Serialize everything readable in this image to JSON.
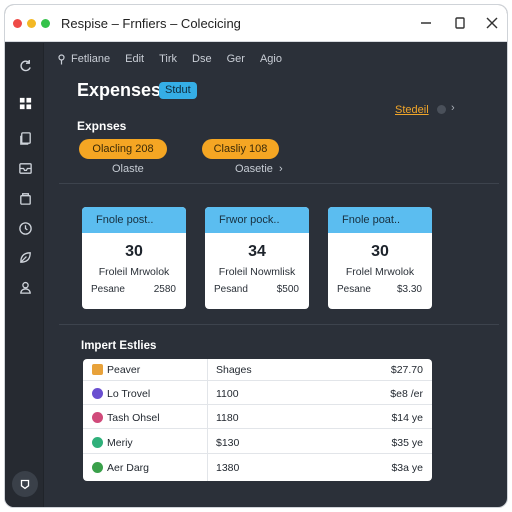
{
  "window": {
    "title": "Respise – Frnfiers – Colecicing"
  },
  "menu": {
    "items": [
      {
        "label": "Fetliane",
        "icon": "pin-icon"
      },
      {
        "label": "Edit"
      },
      {
        "label": "Tirk"
      },
      {
        "label": "Dse"
      },
      {
        "label": "Ger"
      },
      {
        "label": "Agio"
      }
    ]
  },
  "sidebar": {
    "icons": [
      "refresh-icon",
      "grid-icon",
      "copy-icon",
      "inbox-icon",
      "box-icon",
      "clock-icon",
      "leaf-icon",
      "person-icon"
    ],
    "help_icon": "help-icon"
  },
  "header": {
    "title": "Expenses",
    "badge": "Stdut",
    "link": "Stedeil"
  },
  "section": {
    "label": "Expnses",
    "buttons": [
      {
        "label": "Olacling 208",
        "sub": "Olaste"
      },
      {
        "label": "Clasliy 108",
        "sub": "Oasetie"
      }
    ],
    "chevron": "›"
  },
  "cards": [
    {
      "head": "Fnole post..",
      "value": "30",
      "sub": "Froleil Mrwolok",
      "foot_left": "Pesane",
      "foot_right": "2580"
    },
    {
      "head": "Frwor pock..",
      "value": "34",
      "sub": "Froleil Nowmlisk",
      "foot_left": "Pesand",
      "foot_right": "$500"
    },
    {
      "head": "Fnole poat..",
      "value": "30",
      "sub": "Frolel Mrwolok",
      "foot_left": "Pesane",
      "foot_right": "$3.30"
    }
  ],
  "table": {
    "title": "Impert Estlies",
    "rows": [
      {
        "name": "Peaver",
        "value": "Shages",
        "amount": "$27.70",
        "color": "#e8a23a"
      },
      {
        "name": "Lo Trovel",
        "value": "1100",
        "amount": "$e8 /er",
        "color": "#6a4fd0"
      },
      {
        "name": "Tash Ohsel",
        "value": "1180",
        "amount": "$14 ye",
        "color": "#d04a7a"
      },
      {
        "name": "Meriy",
        "value": "$130",
        "amount": "$35 ye",
        "color": "#2fb07a"
      },
      {
        "name": "Aer Darg",
        "value": "1380",
        "amount": "$3a ye",
        "color": "#3aa04a"
      }
    ]
  },
  "colors": {
    "accent": "#f5a623",
    "card_head": "#5bbdf0",
    "badge": "#35aee6",
    "background": "#2b3039"
  }
}
